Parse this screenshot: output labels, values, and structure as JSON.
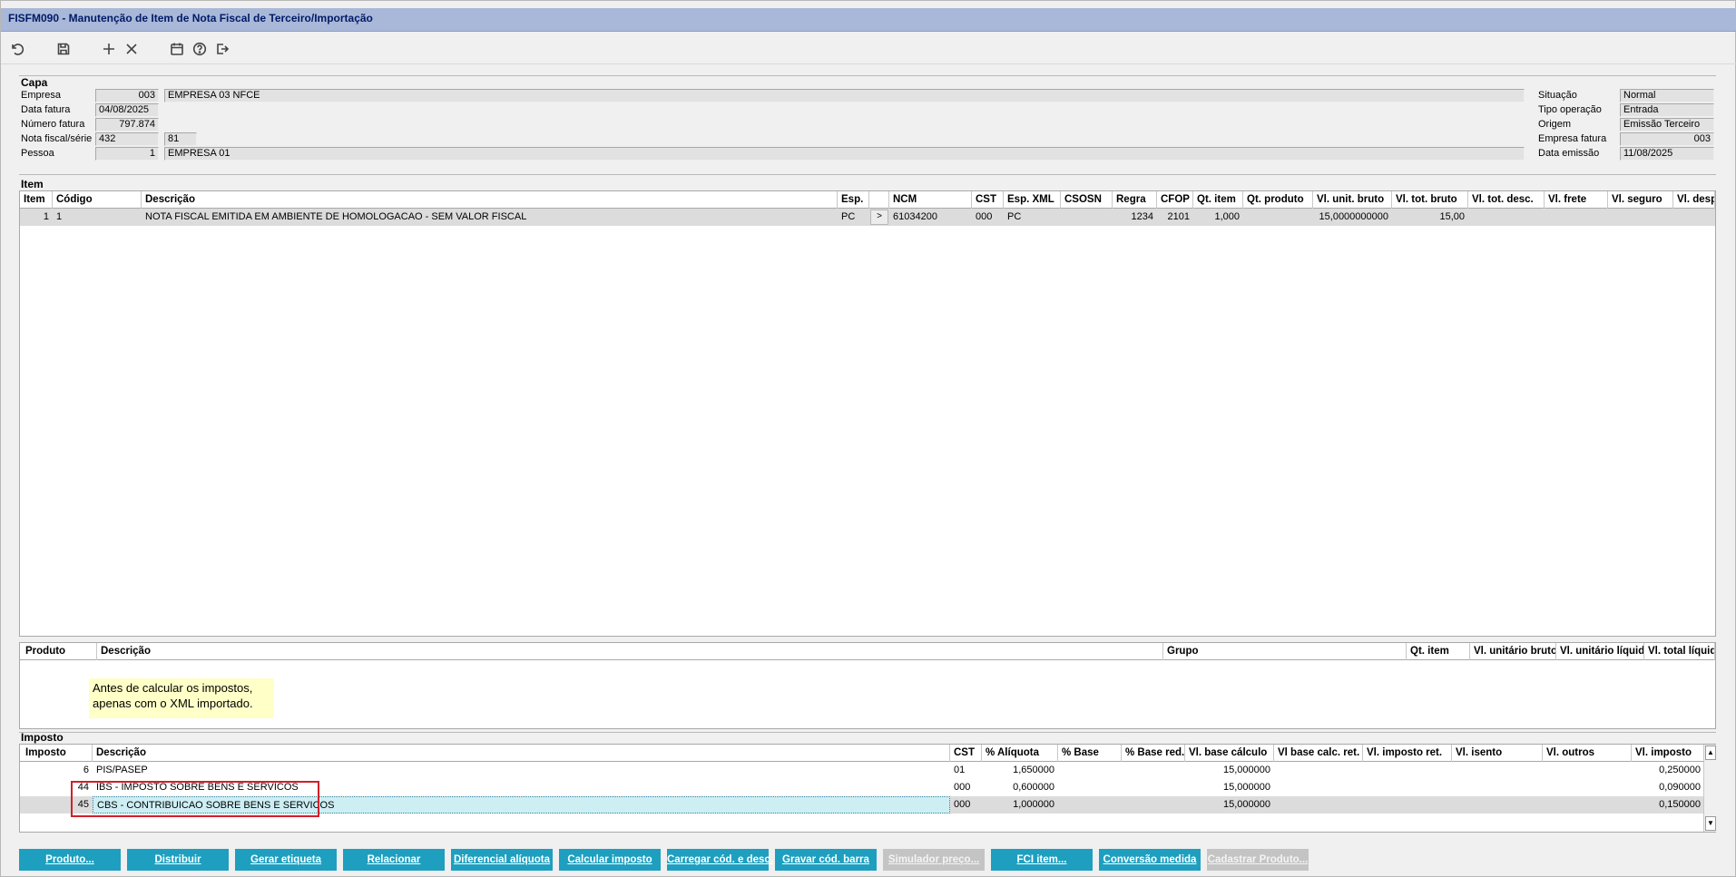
{
  "window": {
    "title": "FISFM090 - Manutenção de Item de Nota Fiscal de Terceiro/Importação"
  },
  "toolbar": {
    "icons": [
      "undo-icon",
      "save-icon",
      "add-icon",
      "close-icon",
      "calendar-icon",
      "help-icon",
      "exit-icon"
    ]
  },
  "capa": {
    "title": "Capa",
    "empresa_label": "Empresa",
    "empresa_code": "003",
    "empresa_name": "EMPRESA 03 NFCE",
    "data_fatura_label": "Data fatura",
    "data_fatura": "04/08/2025",
    "numero_fatura_label": "Número fatura",
    "numero_fatura": "797.874",
    "nota_label": "Nota fiscal/série",
    "nota": "432",
    "serie": "81",
    "pessoa_label": "Pessoa",
    "pessoa_code": "1",
    "pessoa_name": "EMPRESA 01",
    "situacao_label": "Situação",
    "situacao": "Normal",
    "tipo_label": "Tipo operação",
    "tipo": "Entrada",
    "origem_label": "Origem",
    "origem": "Emissão Terceiro",
    "empresa_fatura_label": "Empresa fatura",
    "empresa_fatura": "003",
    "data_emissao_label": "Data emissão",
    "data_emissao": "11/08/2025"
  },
  "item": {
    "title": "Item",
    "columns": [
      "Item",
      "Código",
      "Descrição",
      "Esp.",
      "",
      "NCM",
      "CST",
      "Esp. XML",
      "CSOSN",
      "Regra",
      "CFOP",
      "Qt. item",
      "Qt. produto",
      "Vl. unit. bruto",
      "Vl. tot. bruto",
      "Vl. tot. desc.",
      "Vl. frete",
      "Vl. seguro",
      "Vl. desp. ac"
    ],
    "rows": [
      [
        "1",
        "1",
        "NOTA FISCAL EMITIDA EM AMBIENTE DE HOMOLOGACAO - SEM VALOR FISCAL",
        "PC",
        ">",
        "61034200",
        "000",
        "PC",
        "",
        "1234",
        "2101",
        "1,000",
        "",
        "15,0000000000",
        "15,00",
        "",
        "",
        "",
        ""
      ]
    ]
  },
  "produto": {
    "columns": [
      "Produto",
      "Descrição",
      "Grupo",
      "Qt. item",
      "Vl. unitário bruto",
      "Vl. unitário líquido",
      "Vl. total líquido"
    ],
    "note_line1": "Antes de calcular os impostos,",
    "note_line2": "apenas com o XML importado."
  },
  "imposto": {
    "title": "Imposto",
    "columns": [
      "Imposto",
      "Descrição",
      "CST",
      "% Alíquota",
      "% Base",
      "% Base red.",
      "Vl. base cálculo",
      "Vl base calc. ret.",
      "Vl. imposto ret.",
      "Vl. isento",
      "Vl. outros",
      "Vl. imposto"
    ],
    "rows": [
      [
        "6",
        "PIS/PASEP",
        "01",
        "1,650000",
        "",
        "",
        "15,000000",
        "",
        "",
        "",
        "",
        "0,250000"
      ],
      [
        "44",
        "IBS - IMPOSTO SOBRE BENS E SERVICOS",
        "000",
        "0,600000",
        "",
        "",
        "15,000000",
        "",
        "",
        "",
        "",
        "0,090000"
      ],
      [
        "45",
        "CBS - CONTRIBUICAO SOBRE BENS E SERVICOS",
        "000",
        "1,000000",
        "",
        "",
        "15,000000",
        "",
        "",
        "",
        "",
        "0,150000"
      ]
    ]
  },
  "buttons": [
    {
      "label": "Produto...",
      "enabled": true
    },
    {
      "label": "Distribuir",
      "enabled": true
    },
    {
      "label": "Gerar etiqueta",
      "enabled": true
    },
    {
      "label": "Relacionar",
      "enabled": true
    },
    {
      "label": "Diferencial alíquota",
      "enabled": true
    },
    {
      "label": "Calcular imposto",
      "enabled": true
    },
    {
      "label": "Carregar cód. e desc.",
      "enabled": true
    },
    {
      "label": "Gravar cód. barra",
      "enabled": true
    },
    {
      "label": "Simulador preço...",
      "enabled": false
    },
    {
      "label": "FCI item...",
      "enabled": true
    },
    {
      "label": "Conversão medida",
      "enabled": true
    },
    {
      "label": "Cadastrar Produto...",
      "enabled": false
    }
  ],
  "colors": {
    "titlebar": "#a9b8d8",
    "button": "#1e9fbf",
    "selected_row": "#dcdcdc",
    "note": "#ffffc8",
    "highlight_box": "#d0202a"
  }
}
